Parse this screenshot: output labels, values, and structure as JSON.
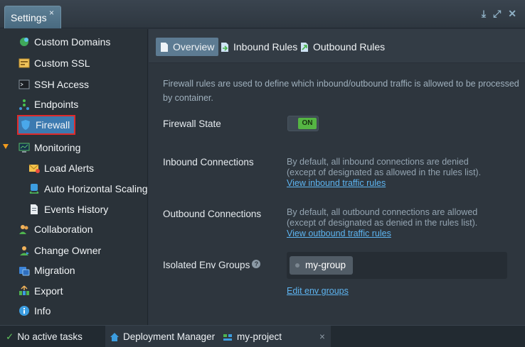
{
  "window": {
    "tab_title": "Settings",
    "tab_close": "×",
    "controls": [
      "⤓",
      "⤢",
      "✕"
    ]
  },
  "sidebar": {
    "items": [
      {
        "label": "Custom Domains",
        "icon": "domains-icon"
      },
      {
        "label": "Custom SSL",
        "icon": "ssl-certificate-icon"
      },
      {
        "label": "SSH Access",
        "icon": "terminal-icon"
      },
      {
        "label": "Endpoints",
        "icon": "endpoints-icon"
      },
      {
        "label": "Firewall",
        "icon": "shield-icon",
        "selected": true
      },
      {
        "label": "Monitoring",
        "icon": "monitor-icon",
        "expanded": true
      },
      {
        "label": "Load Alerts",
        "icon": "mail-alert-icon"
      },
      {
        "label": "Auto Horizontal Scaling",
        "icon": "scaling-icon"
      },
      {
        "label": "Events History",
        "icon": "document-icon"
      },
      {
        "label": "Collaboration",
        "icon": "users-icon"
      },
      {
        "label": "Change Owner",
        "icon": "change-owner-icon"
      },
      {
        "label": "Migration",
        "icon": "migration-icon"
      },
      {
        "label": "Export",
        "icon": "export-icon"
      },
      {
        "label": "Info",
        "icon": "info-icon"
      }
    ]
  },
  "tabs": [
    {
      "label": "Overview",
      "active": true
    },
    {
      "label": "Inbound Rules",
      "active": false
    },
    {
      "label": "Outbound Rules",
      "active": false
    }
  ],
  "overview": {
    "description": "Firewall rules are used to define which inbound/outbound traffic is allowed to be processed by container.",
    "firewall_state": {
      "label": "Firewall State",
      "value": "ON"
    },
    "inbound": {
      "label": "Inbound Connections",
      "text1": "By default, all inbound connections are denied",
      "text2": "(except of designated as allowed in the rules list).",
      "link": "View inbound traffic rules"
    },
    "outbound": {
      "label": "Outbound Connections",
      "text1": "By default, all outbound connections are allowed",
      "text2": "(except of designated as denied in the rules list).",
      "link": "View outbound traffic rules"
    },
    "isolated": {
      "label": "Isolated Env Groups",
      "help": "?",
      "group": "my-group",
      "edit_link": "Edit env groups"
    }
  },
  "statusbar": {
    "tasks": "No active tasks",
    "deployment": "Deployment Manager",
    "project": "my-project",
    "project_close": "×"
  },
  "colors": {
    "accent": "#3c7ab0",
    "on": "#55b543",
    "link": "#5db4f0",
    "selection_outline": "#e02a2a"
  }
}
